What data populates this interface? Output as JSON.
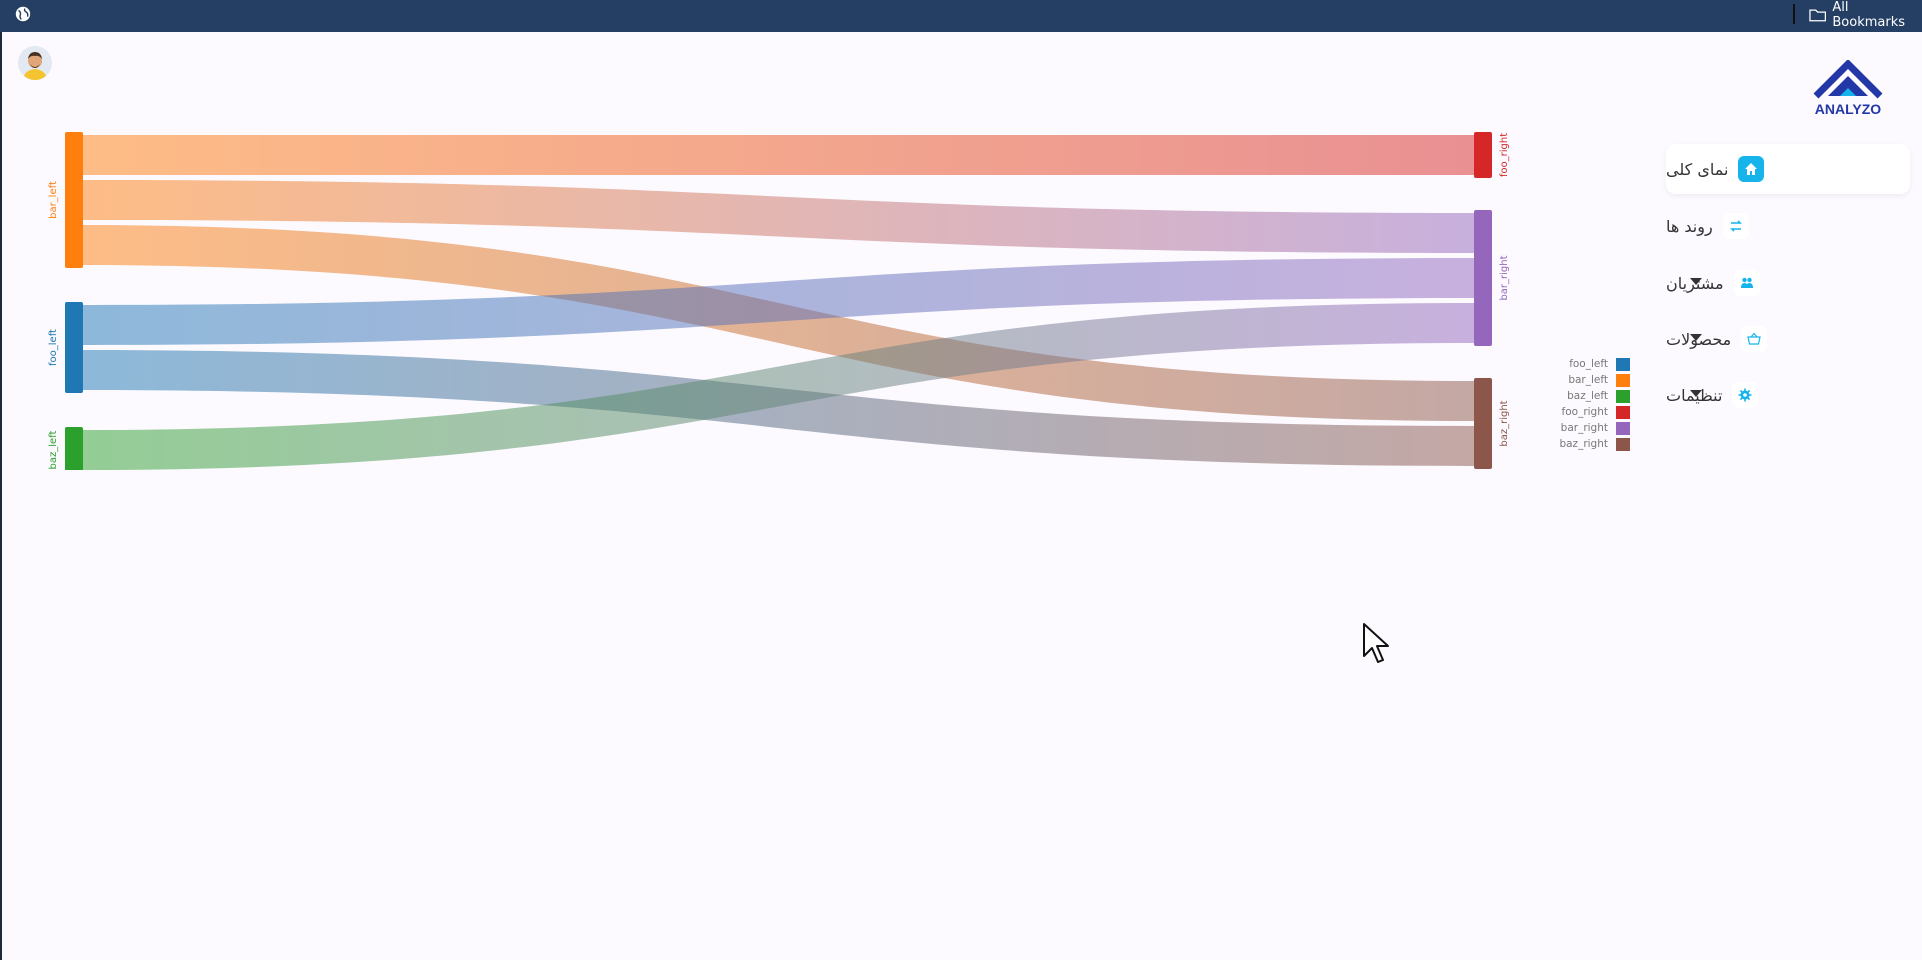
{
  "browser": {
    "bookmarks_label": "All Bookmarks",
    "icons": [
      "globe-icon",
      "folder-icon"
    ]
  },
  "sidebar": {
    "logo_text": "ANALYZO",
    "items": [
      {
        "label": "نمای کلی",
        "icon": "home-icon",
        "active": true,
        "expandable": false
      },
      {
        "label": "روند ها",
        "icon": "trend-icon",
        "active": false,
        "expandable": false
      },
      {
        "label": "مشتریان",
        "icon": "users-icon",
        "active": false,
        "expandable": true
      },
      {
        "label": "محصولات",
        "icon": "basket-icon",
        "active": false,
        "expandable": true
      },
      {
        "label": "تنظیمات",
        "icon": "gear-icon",
        "active": false,
        "expandable": true
      }
    ]
  },
  "colors": {
    "accent": "#16b4ea",
    "topbar": "#243f63",
    "logo": "#2337a6"
  },
  "chart_data": {
    "type": "sankey",
    "nodes": [
      {
        "name": "bar_left",
        "side": "left",
        "color": "#ff7f0e"
      },
      {
        "name": "foo_left",
        "side": "left",
        "color": "#1f77b4"
      },
      {
        "name": "baz_left",
        "side": "left",
        "color": "#2ca02c"
      },
      {
        "name": "foo_right",
        "side": "right",
        "color": "#d62728"
      },
      {
        "name": "bar_right",
        "side": "right",
        "color": "#9467bd"
      },
      {
        "name": "baz_right",
        "side": "right",
        "color": "#8c564b"
      }
    ],
    "links": [
      {
        "source": "bar_left",
        "target": "foo_right",
        "value": 1
      },
      {
        "source": "bar_left",
        "target": "bar_right",
        "value": 1
      },
      {
        "source": "bar_left",
        "target": "baz_right",
        "value": 1
      },
      {
        "source": "foo_left",
        "target": "bar_right",
        "value": 1
      },
      {
        "source": "foo_left",
        "target": "baz_right",
        "value": 1
      },
      {
        "source": "baz_left",
        "target": "bar_right",
        "value": 1
      }
    ],
    "legend": [
      "foo_left",
      "bar_left",
      "baz_left",
      "foo_right",
      "bar_right",
      "baz_right"
    ],
    "legend_position": "right"
  }
}
